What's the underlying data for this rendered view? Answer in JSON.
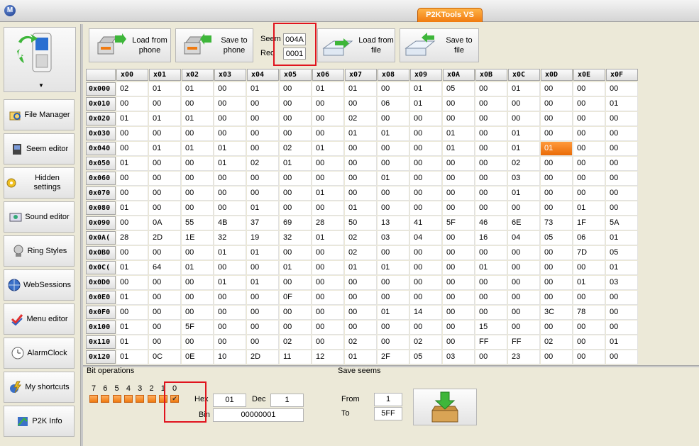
{
  "window": {
    "title": "P2KTools VS",
    "logo_glyph": "M"
  },
  "sidebar": {
    "items": [
      {
        "label": "File Manager",
        "icon": "file-manager-icon"
      },
      {
        "label": "Seem editor",
        "icon": "seem-editor-icon"
      },
      {
        "label": "Hidden settings",
        "icon": "gear-icon"
      },
      {
        "label": "Sound editor",
        "icon": "sound-icon"
      },
      {
        "label": "Ring Styles",
        "icon": "ring-icon"
      },
      {
        "label": "WebSessions",
        "icon": "globe-icon"
      },
      {
        "label": "Menu editor",
        "icon": "menu-icon"
      },
      {
        "label": "AlarmClock",
        "icon": "clock-icon"
      },
      {
        "label": "My shortcuts",
        "icon": "lightning-icon"
      },
      {
        "label": "P2K Info",
        "icon": "info-icon"
      }
    ],
    "logo_arrow": "▼"
  },
  "toolbar": {
    "load_phone": "Load from phone",
    "save_phone": "Save to phone",
    "seem_label": "Seem",
    "seem_value": "004A",
    "rec_label": "Rec",
    "rec_value": "0001",
    "load_file": "Load from file",
    "save_file": "Save to file"
  },
  "grid": {
    "columns": [
      "x00",
      "x01",
      "x02",
      "x03",
      "x04",
      "x05",
      "x06",
      "x07",
      "x08",
      "x09",
      "x0A",
      "x0B",
      "x0C",
      "x0D",
      "x0E",
      "x0F"
    ],
    "rows": [
      {
        "addr": "0x000",
        "cells": [
          "02",
          "01",
          "01",
          "00",
          "01",
          "00",
          "01",
          "01",
          "00",
          "01",
          "05",
          "00",
          "01",
          "00",
          "00",
          "00"
        ]
      },
      {
        "addr": "0x010",
        "cells": [
          "00",
          "00",
          "00",
          "00",
          "00",
          "00",
          "00",
          "00",
          "06",
          "01",
          "00",
          "00",
          "00",
          "00",
          "00",
          "01"
        ]
      },
      {
        "addr": "0x020",
        "cells": [
          "01",
          "01",
          "01",
          "00",
          "00",
          "00",
          "00",
          "02",
          "00",
          "00",
          "00",
          "00",
          "00",
          "00",
          "00",
          "00"
        ]
      },
      {
        "addr": "0x030",
        "cells": [
          "00",
          "00",
          "00",
          "00",
          "00",
          "00",
          "00",
          "01",
          "01",
          "00",
          "01",
          "00",
          "01",
          "00",
          "00",
          "00"
        ]
      },
      {
        "addr": "0x040",
        "cells": [
          "00",
          "01",
          "01",
          "01",
          "00",
          "02",
          "01",
          "00",
          "00",
          "00",
          "01",
          "00",
          "01",
          "01",
          "00",
          "00"
        ]
      },
      {
        "addr": "0x050",
        "cells": [
          "01",
          "00",
          "00",
          "01",
          "02",
          "01",
          "00",
          "00",
          "00",
          "00",
          "00",
          "00",
          "02",
          "00",
          "00",
          "00"
        ]
      },
      {
        "addr": "0x060",
        "cells": [
          "00",
          "00",
          "00",
          "00",
          "00",
          "00",
          "00",
          "00",
          "01",
          "00",
          "00",
          "00",
          "03",
          "00",
          "00",
          "00"
        ]
      },
      {
        "addr": "0x070",
        "cells": [
          "00",
          "00",
          "00",
          "00",
          "00",
          "00",
          "01",
          "00",
          "00",
          "00",
          "00",
          "00",
          "01",
          "00",
          "00",
          "00"
        ]
      },
      {
        "addr": "0x080",
        "cells": [
          "01",
          "00",
          "00",
          "00",
          "01",
          "00",
          "00",
          "01",
          "00",
          "00",
          "00",
          "00",
          "00",
          "00",
          "01",
          "00"
        ]
      },
      {
        "addr": "0x090",
        "cells": [
          "00",
          "0A",
          "55",
          "4B",
          "37",
          "69",
          "28",
          "50",
          "13",
          "41",
          "5F",
          "46",
          "6E",
          "73",
          "1F",
          "5A"
        ]
      },
      {
        "addr": "0x0A(",
        "cells": [
          "28",
          "2D",
          "1E",
          "32",
          "19",
          "32",
          "01",
          "02",
          "03",
          "04",
          "00",
          "16",
          "04",
          "05",
          "06",
          "01"
        ]
      },
      {
        "addr": "0x0B0",
        "cells": [
          "00",
          "00",
          "00",
          "01",
          "01",
          "00",
          "00",
          "02",
          "00",
          "00",
          "00",
          "00",
          "00",
          "00",
          "7D",
          "05"
        ]
      },
      {
        "addr": "0x0C(",
        "cells": [
          "01",
          "64",
          "01",
          "00",
          "00",
          "01",
          "00",
          "01",
          "01",
          "00",
          "00",
          "01",
          "00",
          "00",
          "00",
          "01"
        ]
      },
      {
        "addr": "0x0D0",
        "cells": [
          "00",
          "00",
          "00",
          "01",
          "01",
          "00",
          "00",
          "00",
          "00",
          "00",
          "00",
          "00",
          "00",
          "00",
          "01",
          "03"
        ]
      },
      {
        "addr": "0x0E0",
        "cells": [
          "01",
          "00",
          "00",
          "00",
          "00",
          "0F",
          "00",
          "00",
          "00",
          "00",
          "00",
          "00",
          "00",
          "00",
          "00",
          "00"
        ]
      },
      {
        "addr": "0x0F0",
        "cells": [
          "00",
          "00",
          "00",
          "00",
          "00",
          "00",
          "00",
          "00",
          "01",
          "14",
          "00",
          "00",
          "00",
          "3C",
          "78",
          "00"
        ]
      },
      {
        "addr": "0x100",
        "cells": [
          "01",
          "00",
          "5F",
          "00",
          "00",
          "00",
          "00",
          "00",
          "00",
          "00",
          "00",
          "15",
          "00",
          "00",
          "00",
          "00"
        ]
      },
      {
        "addr": "0x110",
        "cells": [
          "01",
          "00",
          "00",
          "00",
          "00",
          "02",
          "00",
          "02",
          "00",
          "02",
          "00",
          "FF",
          "FF",
          "02",
          "00",
          "01"
        ]
      },
      {
        "addr": "0x120",
        "cells": [
          "01",
          "0C",
          "0E",
          "10",
          "2D",
          "11",
          "12",
          "01",
          "2F",
          "05",
          "03",
          "00",
          "23",
          "00",
          "00",
          "00"
        ]
      }
    ],
    "selected": {
      "row": 4,
      "col": 13
    }
  },
  "bit_ops": {
    "title": "Bit operations",
    "bits": [
      "7",
      "6",
      "5",
      "4",
      "3",
      "2",
      "1",
      "0"
    ],
    "checked_bit": "0",
    "check_glyph": "✔",
    "hex_label": "Hex",
    "hex_value": "01",
    "dec_label": "Dec",
    "dec_value": "1",
    "bin_label": "Bin",
    "bin_value": "00000001"
  },
  "save_seems": {
    "title": "Save seems",
    "from_label": "From",
    "from_value": "1",
    "to_label": "To",
    "to_value": "5FF"
  },
  "colors": {
    "accent": "#f07a10",
    "highlight": "#e0141e"
  }
}
